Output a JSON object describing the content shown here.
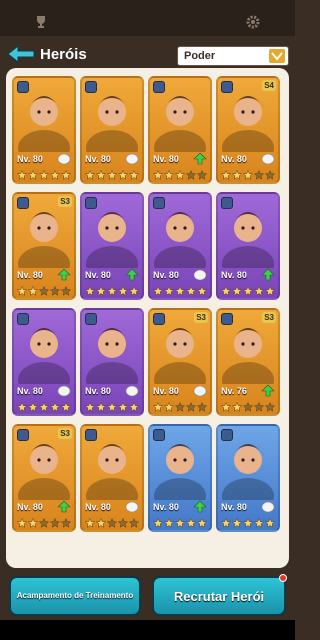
{
  "header": {
    "title": "Heróis",
    "sort_label": "Poder"
  },
  "heroes": [
    {
      "color": "orange",
      "level": "Nv. 80",
      "stars_filled": 5,
      "badge": "",
      "class_icon": "axe-icon",
      "upgrade": false
    },
    {
      "color": "orange",
      "level": "Nv. 80",
      "stars_filled": 5,
      "badge": "",
      "class_icon": "shield-icon",
      "upgrade": false
    },
    {
      "color": "orange",
      "level": "Nv. 80",
      "stars_filled": 3,
      "badge": "",
      "class_icon": "shield-icon",
      "upgrade": true
    },
    {
      "color": "orange",
      "level": "Nv. 80",
      "stars_filled": 3,
      "badge": "S4",
      "class_icon": "axe-icon",
      "upgrade": false
    },
    {
      "color": "orange",
      "level": "Nv. 80",
      "stars_filled": 2,
      "badge": "S3",
      "class_icon": "axe-icon",
      "upgrade": true
    },
    {
      "color": "purple",
      "level": "Nv. 80",
      "stars_filled": 5,
      "badge": "",
      "class_icon": "shield-icon",
      "upgrade": true
    },
    {
      "color": "purple",
      "level": "Nv. 80",
      "stars_filled": 5,
      "badge": "",
      "class_icon": "axe-icon",
      "upgrade": false
    },
    {
      "color": "purple",
      "level": "Nv. 80",
      "stars_filled": 5,
      "badge": "",
      "class_icon": "axe-icon",
      "upgrade": true
    },
    {
      "color": "purple",
      "level": "Nv. 80",
      "stars_filled": 5,
      "badge": "",
      "class_icon": "axe-icon",
      "upgrade": false
    },
    {
      "color": "purple",
      "level": "Nv. 80",
      "stars_filled": 5,
      "badge": "",
      "class_icon": "shield-icon",
      "upgrade": false
    },
    {
      "color": "orange",
      "level": "Nv. 80",
      "stars_filled": 2,
      "badge": "S3",
      "class_icon": "axe-icon",
      "upgrade": false
    },
    {
      "color": "orange",
      "level": "Nv. 76",
      "stars_filled": 2,
      "badge": "S3",
      "class_icon": "shield-icon",
      "upgrade": true
    },
    {
      "color": "orange",
      "level": "Nv. 80",
      "stars_filled": 2,
      "badge": "S3",
      "class_icon": "axe-icon",
      "upgrade": true
    },
    {
      "color": "orange",
      "level": "Nv. 80",
      "stars_filled": 2,
      "badge": "",
      "class_icon": "shield-icon",
      "upgrade": false
    },
    {
      "color": "blue",
      "level": "Nv. 80",
      "stars_filled": 5,
      "badge": "",
      "class_icon": "axe-icon",
      "upgrade": true
    },
    {
      "color": "blue",
      "level": "Nv. 80",
      "stars_filled": 5,
      "badge": "",
      "class_icon": "shield-icon",
      "upgrade": false
    }
  ],
  "bottom_cards": [
    "blue",
    "orange",
    "purple",
    "blue"
  ],
  "footer": {
    "camp_button": "Acampamento de Treinamento",
    "recruit_button": "Recrutar Herói"
  },
  "colors": {
    "orange": "#f0a93a",
    "purple": "#9f69d8",
    "blue": "#6ea6e8",
    "accent": "#2ec3d6",
    "star_filled": "#f5d36a",
    "star_empty": "#8a6a34"
  }
}
